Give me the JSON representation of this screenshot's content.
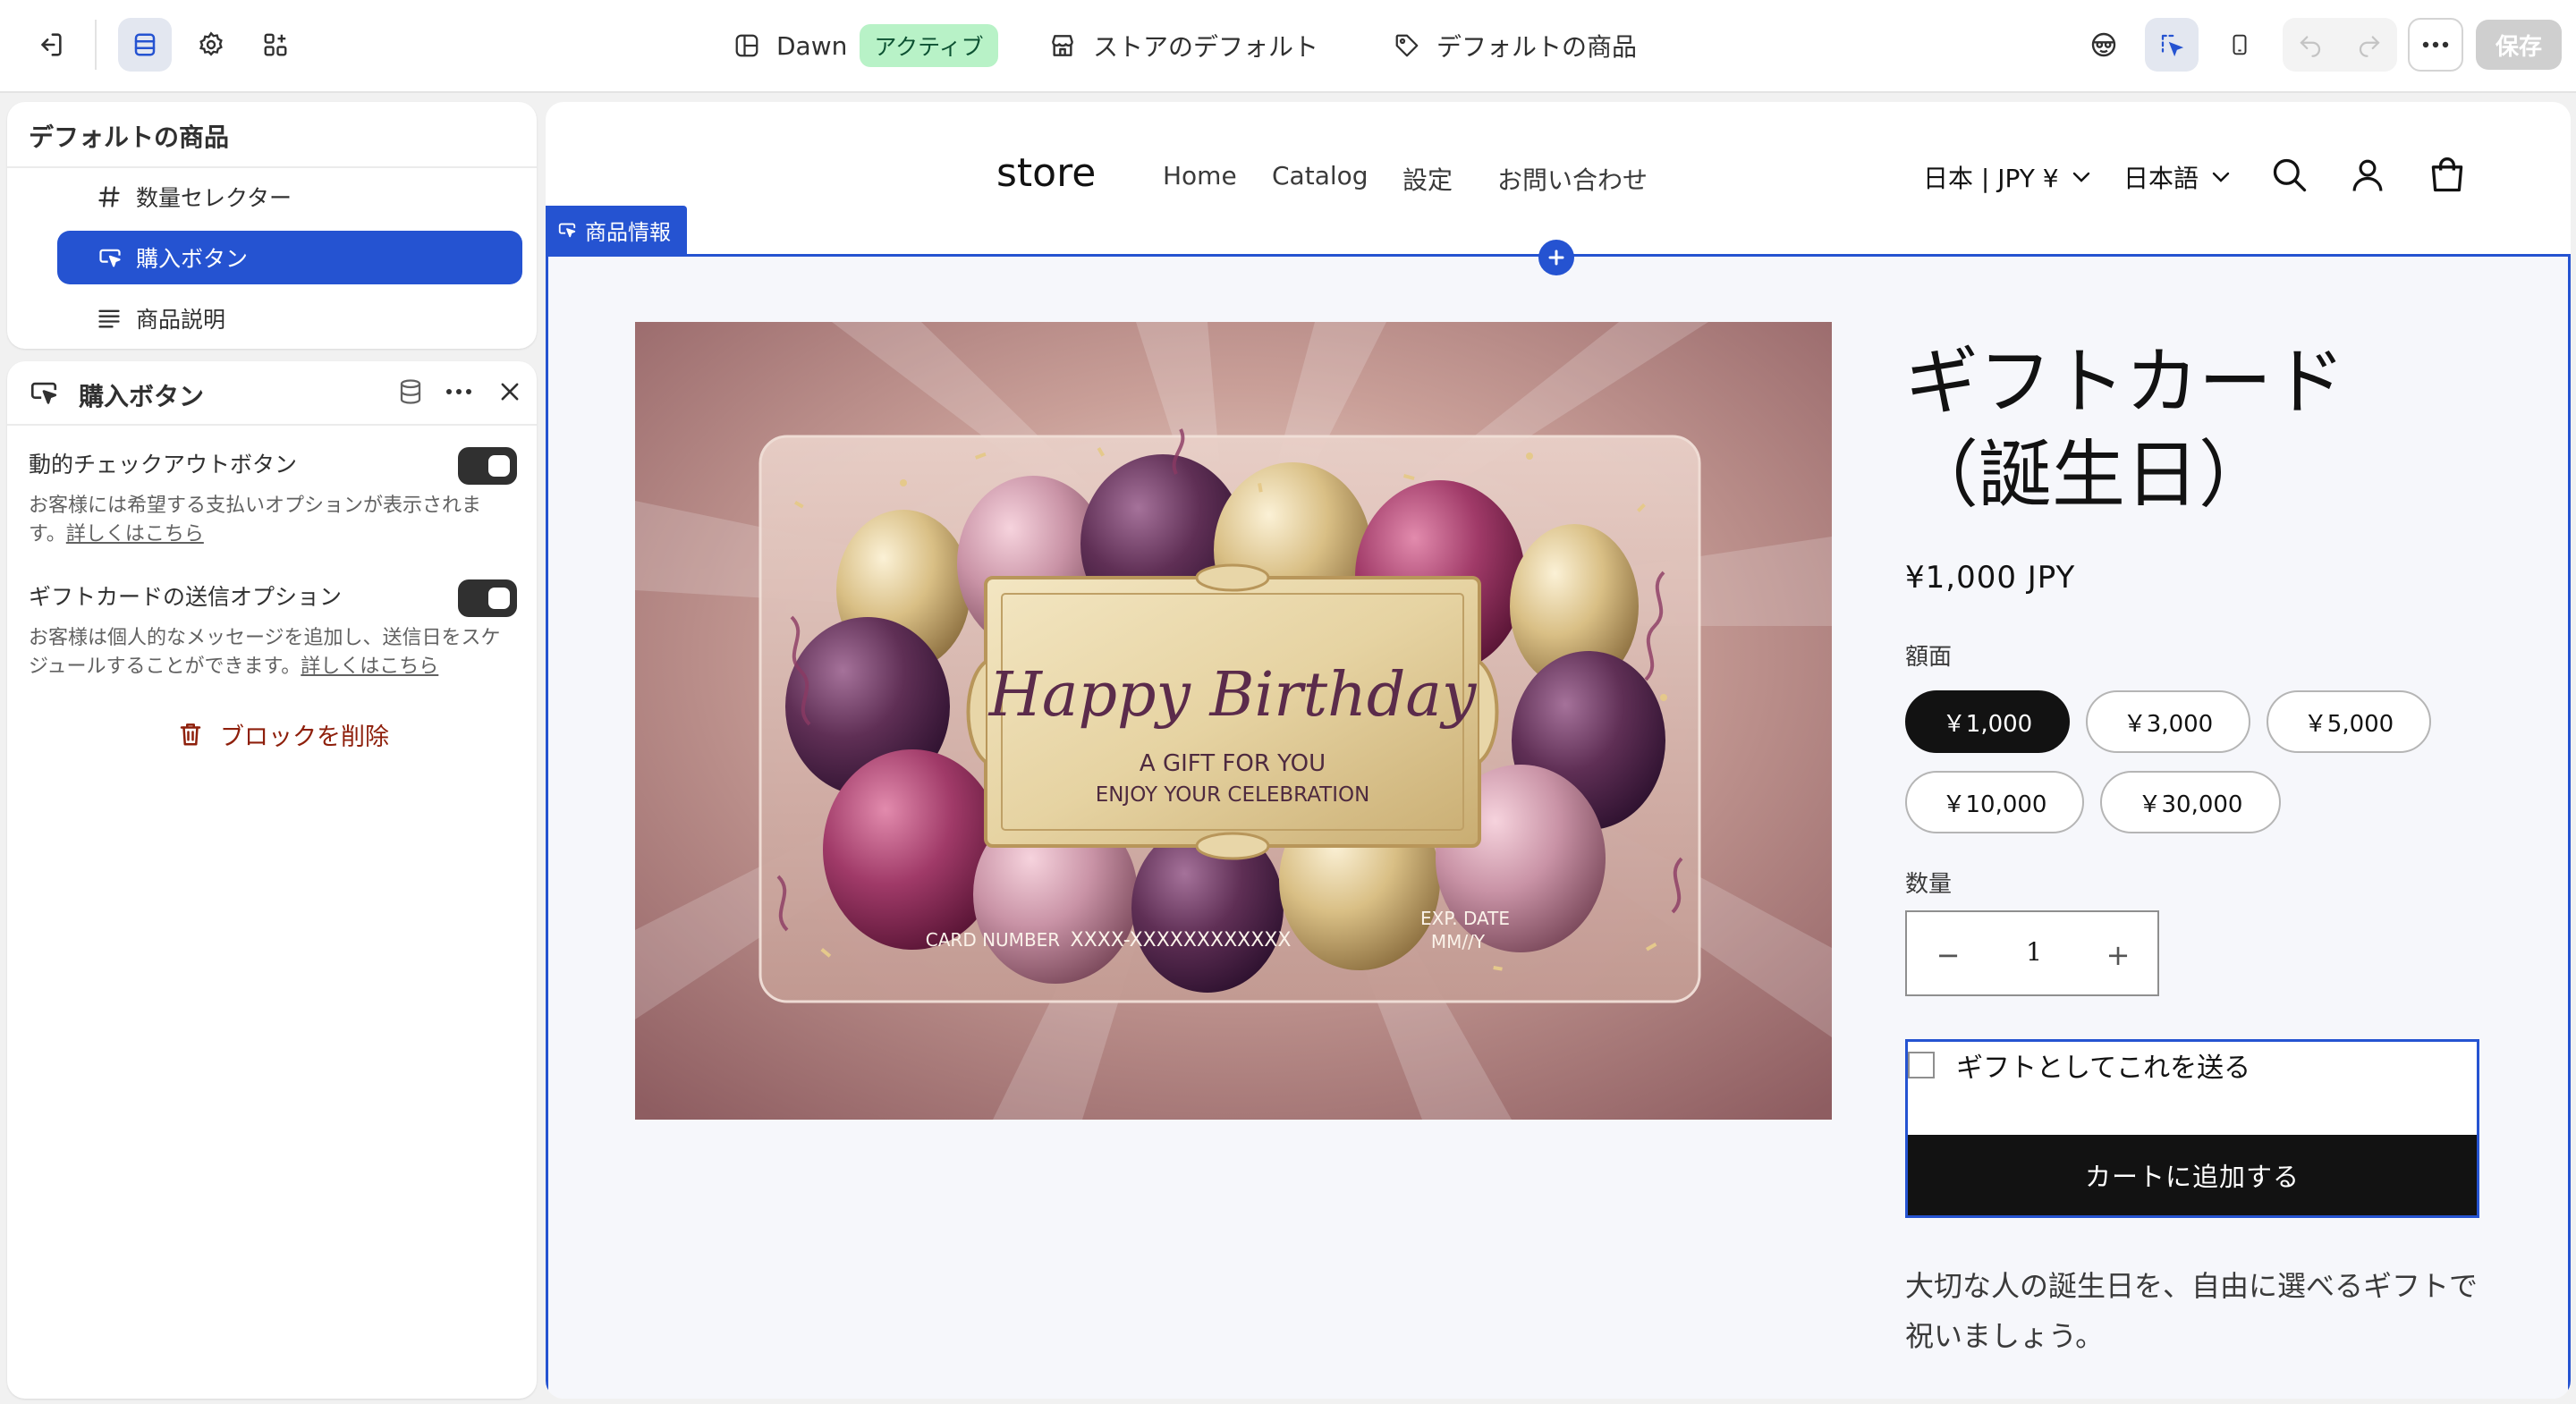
{
  "topbar": {
    "theme_name": "Dawn",
    "theme_status": "アクティブ",
    "store_default": "ストアのデフォルト",
    "default_product": "デフォルトの商品",
    "save_label": "保存"
  },
  "blocks_panel": {
    "title": "デフォルトの商品",
    "items": [
      {
        "label": "数量セレクター",
        "icon": "hash-icon"
      },
      {
        "label": "購入ボタン",
        "icon": "buy-button-icon",
        "selected": true
      },
      {
        "label": "商品説明",
        "icon": "text-lines-icon"
      }
    ]
  },
  "settings_panel": {
    "title": "購入ボタン",
    "options": [
      {
        "label": "動的チェックアウトボタン",
        "help": "お客様には希望する支払いオプションが表示されます。",
        "link": "詳しくはこちら",
        "enabled": true
      },
      {
        "label": "ギフトカードの送信オプション",
        "help": "お客様は個人的なメッセージを追加し、送信日をスケジュールすることができます。",
        "link": "詳しくはこちら",
        "enabled": true
      }
    ],
    "delete_label": "ブロックを削除"
  },
  "preview": {
    "store_name": "store",
    "nav": [
      "Home",
      "Catalog",
      "設定",
      "お問い合わせ"
    ],
    "currency_selector": "日本 | JPY ¥",
    "language_selector": "日本語",
    "section_tag": "商品情報",
    "card_image": {
      "headline": "Happy Birthday",
      "line1": "A GIFT FOR YOU",
      "line2": "ENJOY YOUR CELEBRATION",
      "card_number_label": "CARD NUMBER",
      "card_number": "XXXX-XXXXXXXXXXXX",
      "exp_label": "EXP. DATE",
      "exp_value": "MM//Y"
    },
    "product": {
      "title_line1": "ギフトカード",
      "title_line2": "（誕生日）",
      "price": "¥1,000 JPY",
      "denomination_label": "額面",
      "denominations": [
        "￥1,000",
        "￥3,000",
        "￥5,000",
        "￥10,000",
        "￥30,000"
      ],
      "selected_denomination": "￥1,000",
      "quantity_label": "数量",
      "quantity": "1",
      "quantity_minus": "−",
      "quantity_plus": "+",
      "gift_checkbox_label": "ギフトとしてこれを送る",
      "add_to_cart": "カートに追加する",
      "description": "大切な人の誕生日を、自由に選べるギフトで祝いましょう。"
    }
  },
  "colors": {
    "accent": "#2553d1",
    "active_badge_bg": "#b8f2c7",
    "active_badge_text": "#0c5132",
    "delete_text": "#8e1f0b",
    "button_dark": "#121212"
  }
}
